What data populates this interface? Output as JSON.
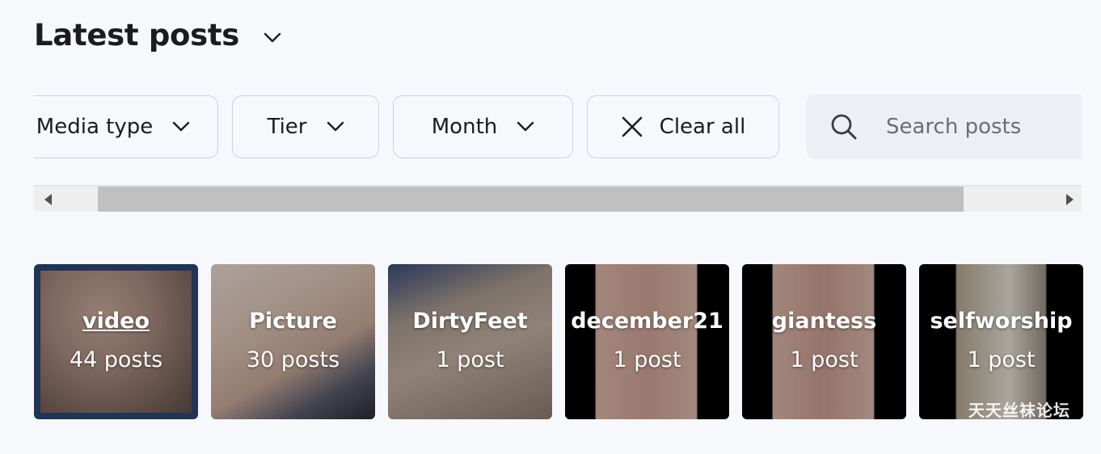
{
  "header": {
    "title": "Latest posts"
  },
  "filters": {
    "media_type": "Media type",
    "tier": "Tier",
    "month": "Month",
    "clear_all": "Clear all"
  },
  "search": {
    "placeholder": "Search posts",
    "value": ""
  },
  "scrollbar": {
    "position": 0.0
  },
  "tiles": [
    {
      "name": "video",
      "count": "44 posts",
      "selected": true
    },
    {
      "name": "Picture",
      "count": "30 posts",
      "selected": false
    },
    {
      "name": "DirtyFeet",
      "count": "1 post",
      "selected": false
    },
    {
      "name": "december21",
      "count": "1 post",
      "selected": false
    },
    {
      "name": "giantess",
      "count": "1 post",
      "selected": false
    },
    {
      "name": "selfworship",
      "count": "1 post",
      "selected": false
    }
  ],
  "watermark": "天天丝袜论坛",
  "icons": {
    "title_chevron": "chevron-down-icon",
    "filter_chevron": "chevron-down-icon",
    "clear": "close-icon",
    "search": "search-icon"
  },
  "colors": {
    "background": "#f7f8fc",
    "selected_border": "#1f3456",
    "search_bg": "#edeff6"
  }
}
